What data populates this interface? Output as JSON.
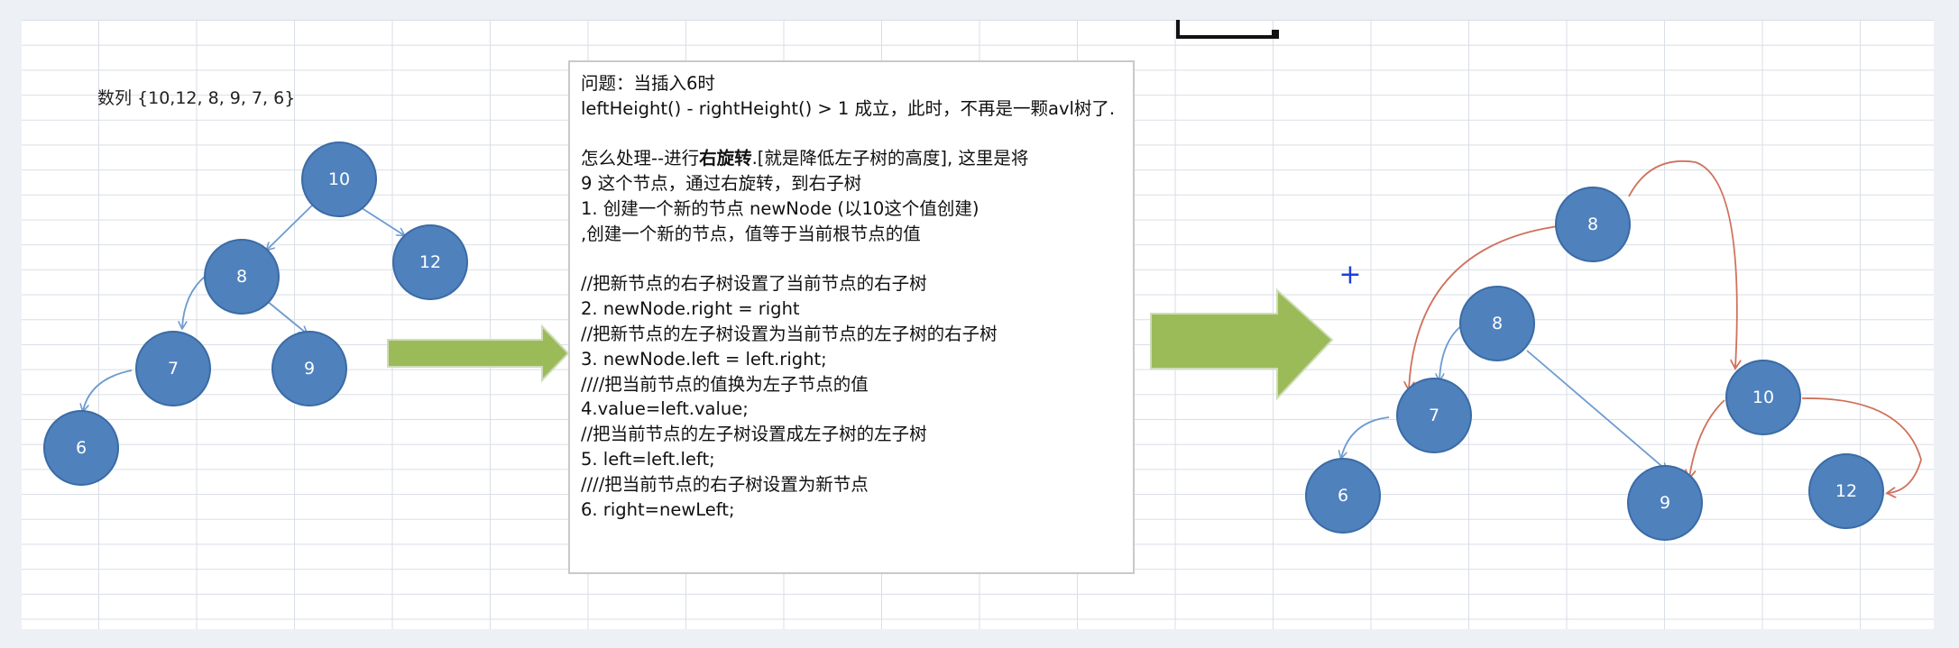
{
  "array_label": "数列 {10,12, 8, 9, 7, 6}",
  "note": {
    "line1": "问题：当插入6时",
    "line2": "leftHeight() - rightHeight() > 1 成立，此时，不再是一颗avl树了.",
    "line3_pre": "怎么处理--进行",
    "line3_bold": "右旋转",
    "line3_post": ".[就是降低左子树的高度], 这里是将",
    "line4": "9 这个节点，通过右旋转，到右子树",
    "line5": "1. 创建一个新的节点 newNode (以10这个值创建)",
    "line6": ",创建一个新的节点，值等于当前根节点的值",
    "line7": "//把新节点的右子树设置了当前节点的右子树",
    "line8": "2. newNode.right = right",
    "line9": "//把新节点的左子树设置为当前节点的左子树的右子树",
    "line10": "3. newNode.left = left.right;",
    "line11": "////把当前节点的值换为左子节点的值",
    "line12": "4.value=left.value;",
    "line13": "//把当前节点的左子树设置成左子树的左子树",
    "line14": "5. left=left.left;",
    "line15": "////把当前节点的右子树设置为新节点",
    "line16": "6. right=newLeft;"
  },
  "left_tree": {
    "n10": "10",
    "n12": "12",
    "n8": "8",
    "n7": "7",
    "n9": "9",
    "n6": "6"
  },
  "right_tree": {
    "n8a": "8",
    "n8b": "8",
    "n7": "7",
    "n10": "10",
    "n6": "6",
    "n9": "9",
    "n12": "12"
  },
  "cursor_glyph": "+",
  "colors": {
    "node_fill": "#4f81bd",
    "node_stroke": "#3a6ba5",
    "edge_blue": "#6d9bd0",
    "edge_red": "#d0715c",
    "arrow_green": "#9bbb59",
    "cursor_blue": "#1f3fd6"
  }
}
